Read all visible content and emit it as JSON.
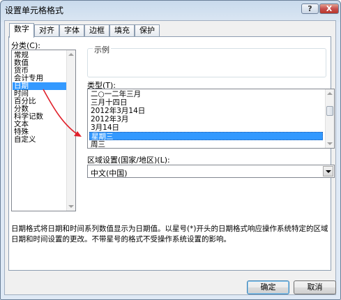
{
  "window": {
    "title": "设置单元格格式",
    "help_label": "?",
    "close_label": "X"
  },
  "tabs": [
    {
      "label": "数字",
      "active": true
    },
    {
      "label": "对齐"
    },
    {
      "label": "字体"
    },
    {
      "label": "边框"
    },
    {
      "label": "填充"
    },
    {
      "label": "保护"
    }
  ],
  "category": {
    "label": "分类(C):",
    "items": [
      "常规",
      "数值",
      "货币",
      "会计专用",
      "日期",
      "时间",
      "百分比",
      "分数",
      "科学记数",
      "文本",
      "特殊",
      "自定义"
    ],
    "selected": "日期"
  },
  "sample": {
    "label": "示例"
  },
  "type": {
    "label": "类型(T):",
    "items": [
      "二○一二年三月",
      "三月十四日",
      "2012年3月14日",
      "2012年3月",
      "3月14日",
      "星期三",
      "周三"
    ],
    "selected": "星期三"
  },
  "locale": {
    "label": "区域设置(国家/地区)(L):",
    "value": "中文(中国)"
  },
  "description": "日期格式将日期和时间系列数值显示为日期值。以星号(*)开头的日期格式响应操作系统特定的区域日期和时间设置的更改。不带星号的格式不受操作系统设置的影响。",
  "buttons": {
    "ok": "确定",
    "cancel": "取消"
  },
  "colors": {
    "selection": "#3399ff",
    "annotation_arrow": "#e0202a"
  }
}
